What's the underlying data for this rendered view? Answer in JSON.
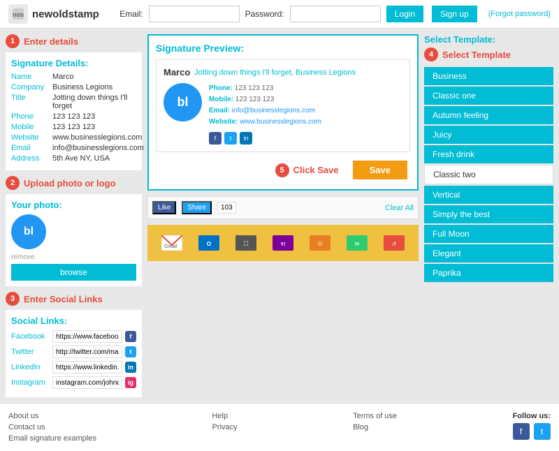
{
  "header": {
    "logo_text": "newoldstamp",
    "email_label": "Email:",
    "password_label": "Password:",
    "email_placeholder": "",
    "password_placeholder": "",
    "login_btn": "Login",
    "signup_btn": "Sign up",
    "forgot": "(Forgot password)"
  },
  "steps": {
    "step1_label": "Enter details",
    "step2_label": "Upload photo or logo",
    "step3_label": "Enter Social Links",
    "step4_label": "Select Template",
    "step5_label": "Click Save"
  },
  "signature_details": {
    "title": "Signature Details:",
    "fields": [
      {
        "label": "Name",
        "value": "Marco"
      },
      {
        "label": "Company",
        "value": "Business Legions"
      },
      {
        "label": "Title",
        "value": "Jotting down things I'll forget"
      },
      {
        "label": "Phone",
        "value": "123 123 123"
      },
      {
        "label": "Mobile",
        "value": "123 123 123"
      },
      {
        "label": "Website",
        "value": "www.businesslegions.com"
      },
      {
        "label": "Email",
        "value": "info@businesslegions.com"
      },
      {
        "label": "Address",
        "value": "5th Ave NY, USA"
      }
    ]
  },
  "photo_section": {
    "title": "Your photo:",
    "logo_initials": "bl",
    "remove_text": "remove",
    "browse_btn": "browse"
  },
  "social_links": {
    "title": "Social Links:",
    "fields": [
      {
        "label": "Facebook",
        "value": "https://www.facebook.com/",
        "icon": "f",
        "color": "#3b5998"
      },
      {
        "label": "Twitter",
        "value": "http://twitter.com/marco_tr...",
        "icon": "t",
        "color": "#1da1f2"
      },
      {
        "label": "LinkedIn",
        "value": "https://www.linkedin.com/ir...",
        "icon": "in",
        "color": "#0077b5"
      },
      {
        "label": "Instagram",
        "value": "instagram.com/johndoe",
        "icon": "ig",
        "color": "#e1306c"
      }
    ]
  },
  "preview": {
    "title": "Signature Preview:",
    "sig_name": "Marco",
    "sig_tagline": "Jotting down things I'll forget, Business Legions",
    "sig_logo": "bl",
    "phone_label": "Phone:",
    "phone_value": "123 123 123",
    "mobile_label": "Mobile:",
    "mobile_value": "123 123 123",
    "email_label": "Email:",
    "email_value": "info@businesslegions.com",
    "website_label": "Website:",
    "website_value": "www.businesslegions.com"
  },
  "save_section": {
    "click_save_text": "Click Save",
    "save_btn": "Save"
  },
  "share_bar": {
    "like_btn": "Like",
    "share_btn": "Share",
    "count": "103",
    "clear_btn": "Clear All"
  },
  "email_clients": {
    "gmail": "Gmail",
    "outlook": "Outlook",
    "apple": "Apple",
    "yahoo": "Yahoo",
    "other1": "",
    "other2": "",
    "other3": ""
  },
  "templates": {
    "title": "Select Template:",
    "step4_label": "Select Template",
    "items": [
      {
        "name": "Business",
        "active": true
      },
      {
        "name": "Classic one",
        "active": true
      },
      {
        "name": "Autumn feeling",
        "active": true
      },
      {
        "name": "Juicy",
        "active": true
      },
      {
        "name": "Fresh drink",
        "active": true
      },
      {
        "name": "Classic two",
        "active": false
      },
      {
        "name": "Vertical",
        "active": true
      },
      {
        "name": "Simply the best",
        "active": true
      },
      {
        "name": "Full Moon",
        "active": true
      },
      {
        "name": "Elegant",
        "active": true
      },
      {
        "name": "Paprika",
        "active": true
      }
    ]
  },
  "footer": {
    "col1": [
      "About us",
      "Contact us",
      "Email signature examples"
    ],
    "col2": [
      "Help",
      "Privacy"
    ],
    "col3": [
      "Terms of use",
      "Blog"
    ],
    "follow_label": "Follow us:"
  }
}
